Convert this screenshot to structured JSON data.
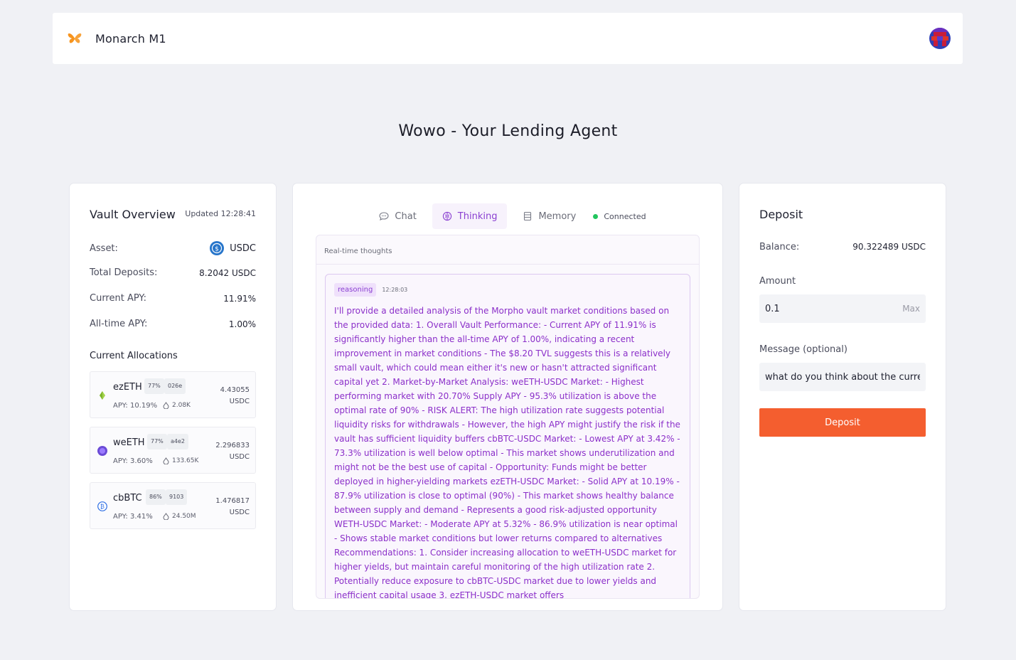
{
  "header": {
    "app_name": "Monarch M1"
  },
  "page": {
    "heading": "Wowo - Your Lending Agent"
  },
  "vault": {
    "title": "Vault Overview",
    "updated": "Updated 12:28:41",
    "asset_label": "Asset:",
    "asset_value": "USDC",
    "deposits_label": "Total Deposits:",
    "deposits_value": "8.2042 USDC",
    "apy_label": "Current APY:",
    "apy_value": "11.91%",
    "alltime_label": "All-time APY:",
    "alltime_value": "1.00%",
    "allocations_title": "Current Allocations",
    "allocations": [
      {
        "name": "ezETH",
        "pct": "77%",
        "id": "026e",
        "apy": "APY: 10.19%",
        "liq": "2.08K",
        "amount": "4.43055",
        "unit": "USDC",
        "icon": "ezeth-icon",
        "color": "#a3d34a"
      },
      {
        "name": "weETH",
        "pct": "77%",
        "id": "a4e2",
        "apy": "APY: 3.60%",
        "liq": "133.65K",
        "amount": "2.296833",
        "unit": "USDC",
        "icon": "weeth-icon",
        "color": "#6b4bd6"
      },
      {
        "name": "cbBTC",
        "pct": "86%",
        "id": "9103",
        "apy": "APY: 3.41%",
        "liq": "24.50M",
        "amount": "1.476817",
        "unit": "USDC",
        "icon": "cbbtc-icon",
        "color": "#2f6fe4"
      }
    ]
  },
  "agent": {
    "tabs": [
      {
        "label": "Chat",
        "icon": "chat-icon",
        "active": false
      },
      {
        "label": "Thinking",
        "icon": "brain-icon",
        "active": true
      },
      {
        "label": "Memory",
        "icon": "memory-icon",
        "active": false
      }
    ],
    "status": "Connected",
    "panel_title": "Real-time thoughts",
    "thought": {
      "tag": "reasoning",
      "time": "12:28:03",
      "text": "I'll provide a detailed analysis of the Morpho vault market conditions based on the provided data: 1. Overall Vault Performance: - Current APY of 11.91% is significantly higher than the all-time APY of 1.00%, indicating a recent improvement in market conditions - The $8.20 TVL suggests this is a relatively small vault, which could mean either it's new or hasn't attracted significant capital yet 2. Market-by-Market Analysis: weETH-USDC Market: - Highest performing market with 20.70% Supply APY - 95.3% utilization is above the optimal rate of 90% - RISK ALERT: The high utilization rate suggests potential liquidity risks for withdrawals - However, the high APY might justify the risk if the vault has sufficient liquidity buffers cbBTC-USDC Market: - Lowest APY at 3.42% - 73.3% utilization is well below optimal - This market shows underutilization and might not be the best use of capital - Opportunity: Funds might be better deployed in higher-yielding markets ezETH-USDC Market: - Solid APY at 10.19% - 87.9% utilization is close to optimal (90%) - This market shows healthy balance between supply and demand - Represents a good risk-adjusted opportunity WETH-USDC Market: - Moderate APY at 5.32% - 86.9% utilization is near optimal - Shows stable market conditions but lower returns compared to alternatives Recommendations: 1. Consider increasing allocation to weETH-USDC market for higher yields, but maintain careful monitoring of the high utilization rate 2. Potentially reduce exposure to cbBTC-USDC market due to lower yields and inefficient capital usage 3. ezETH-USDC market offers"
    }
  },
  "deposit": {
    "title": "Deposit",
    "balance_label": "Balance:",
    "balance_value": "90.322489 USDC",
    "amount_label": "Amount",
    "amount_value": "0.1",
    "max_label": "Max",
    "message_label": "Message (optional)",
    "message_value": "what do you think about the current",
    "button": "Deposit"
  },
  "colors": {
    "accent": "#f45e2f",
    "purple": "#8a3fd1",
    "status": "#22c55e"
  }
}
